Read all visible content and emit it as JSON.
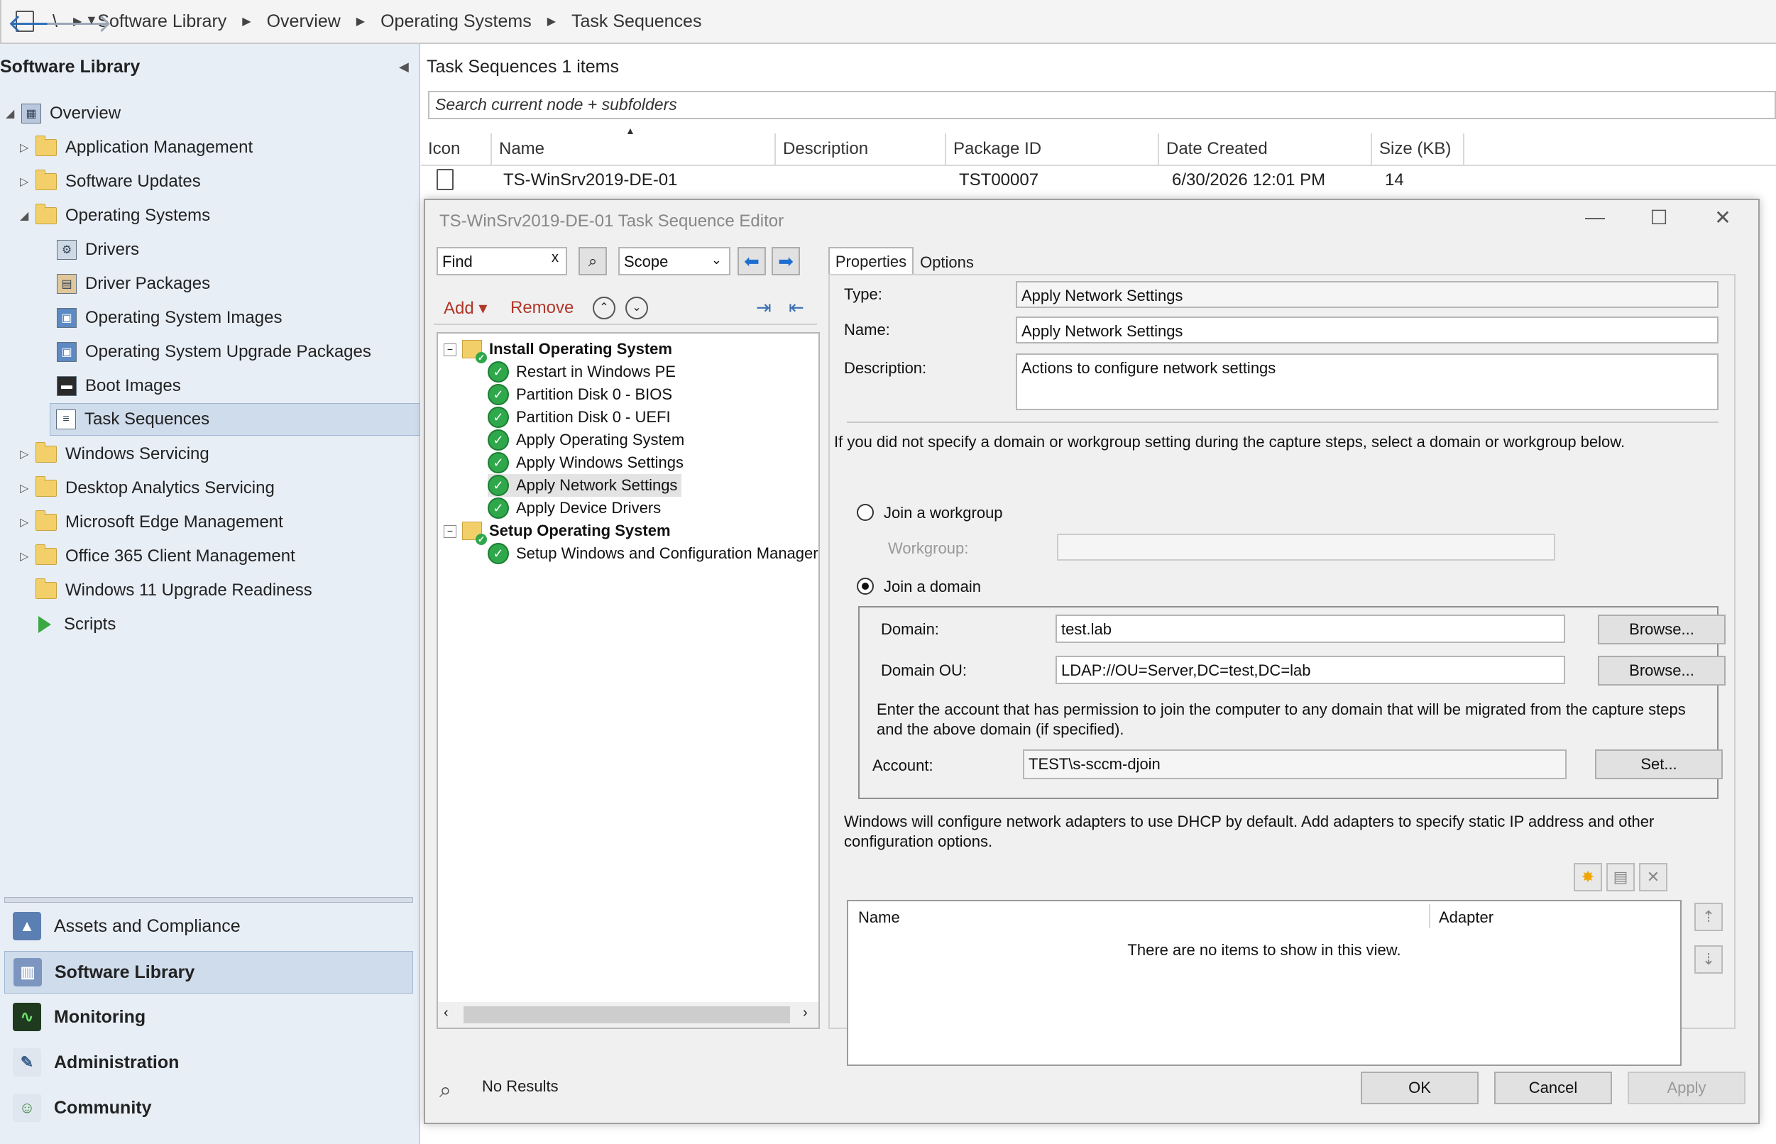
{
  "breadcrumb": {
    "root": "\\",
    "items": [
      "Software Library",
      "Overview",
      "Operating Systems",
      "Task Sequences"
    ]
  },
  "leftnav": {
    "title": "Software Library",
    "overview": "Overview",
    "items": [
      {
        "label": "Application Management"
      },
      {
        "label": "Software Updates"
      },
      {
        "label": "Operating Systems"
      },
      {
        "label": "Windows Servicing"
      },
      {
        "label": "Desktop Analytics Servicing"
      },
      {
        "label": "Microsoft Edge Management"
      },
      {
        "label": "Office 365 Client Management"
      },
      {
        "label": "Windows 11 Upgrade Readiness"
      },
      {
        "label": "Scripts"
      }
    ],
    "os_children": [
      "Drivers",
      "Driver Packages",
      "Operating System Images",
      "Operating System Upgrade Packages",
      "Boot Images",
      "Task Sequences"
    ],
    "workspaces": [
      "Assets and Compliance",
      "Software Library",
      "Monitoring",
      "Administration",
      "Community"
    ]
  },
  "content": {
    "header": "Task Sequences 1 items",
    "search_placeholder": "Search current node + subfolders",
    "columns": [
      "Icon",
      "Name",
      "Description",
      "Package ID",
      "Date Created",
      "Size (KB)"
    ],
    "row": {
      "name": "TS-WinSrv2019-DE-01",
      "description": "",
      "package_id": "TST00007",
      "date_created": "6/30/2026 12:01 PM",
      "size": "14"
    }
  },
  "dialog": {
    "title": "TS-WinSrv2019-DE-01 Task Sequence Editor",
    "find_value": "Find",
    "find_clear": "x",
    "scope_value": "Scope",
    "add_label": "Add",
    "remove_label": "Remove",
    "group1": "Install Operating System",
    "group1_steps": [
      "Restart in Windows PE",
      "Partition Disk 0 - BIOS",
      "Partition Disk 0 - UEFI",
      "Apply Operating System",
      "Apply Windows Settings",
      "Apply Network Settings",
      "Apply Device Drivers"
    ],
    "group2": "Setup Operating System",
    "group2_steps": [
      "Setup Windows and Configuration Manager"
    ],
    "no_results": "No Results",
    "tabs": [
      "Properties",
      "Options"
    ],
    "props": {
      "type_label": "Type:",
      "type_value": "Apply Network Settings",
      "name_label": "Name:",
      "name_value": "Apply Network Settings",
      "description_label": "Description:",
      "description_value": "Actions to configure network settings",
      "info_text": "If you did not specify a domain or workgroup setting during the capture steps, select a domain or workgroup below.",
      "join_workgroup": "Join a workgroup",
      "workgroup_label": "Workgroup:",
      "join_domain": "Join a domain",
      "domain_label": "Domain:",
      "domain_value": "test.lab",
      "domain_ou_label": "Domain OU:",
      "domain_ou_value": "LDAP://OU=Server,DC=test,DC=lab",
      "browse_label": "Browse...",
      "account_info": "Enter the account that has permission to join the computer to any domain that will be migrated from the capture steps and the above domain (if specified).",
      "account_label": "Account:",
      "account_value": "TEST\\s-sccm-djoin",
      "set_label": "Set...",
      "adapters_info": "Windows will configure network adapters to use DHCP by default. Add adapters to specify static IP address and other configuration options.",
      "adapter_columns": [
        "Name",
        "Adapter"
      ],
      "adapter_empty": "There are no items to show in this view."
    },
    "buttons": {
      "ok": "OK",
      "cancel": "Cancel",
      "apply": "Apply"
    }
  }
}
